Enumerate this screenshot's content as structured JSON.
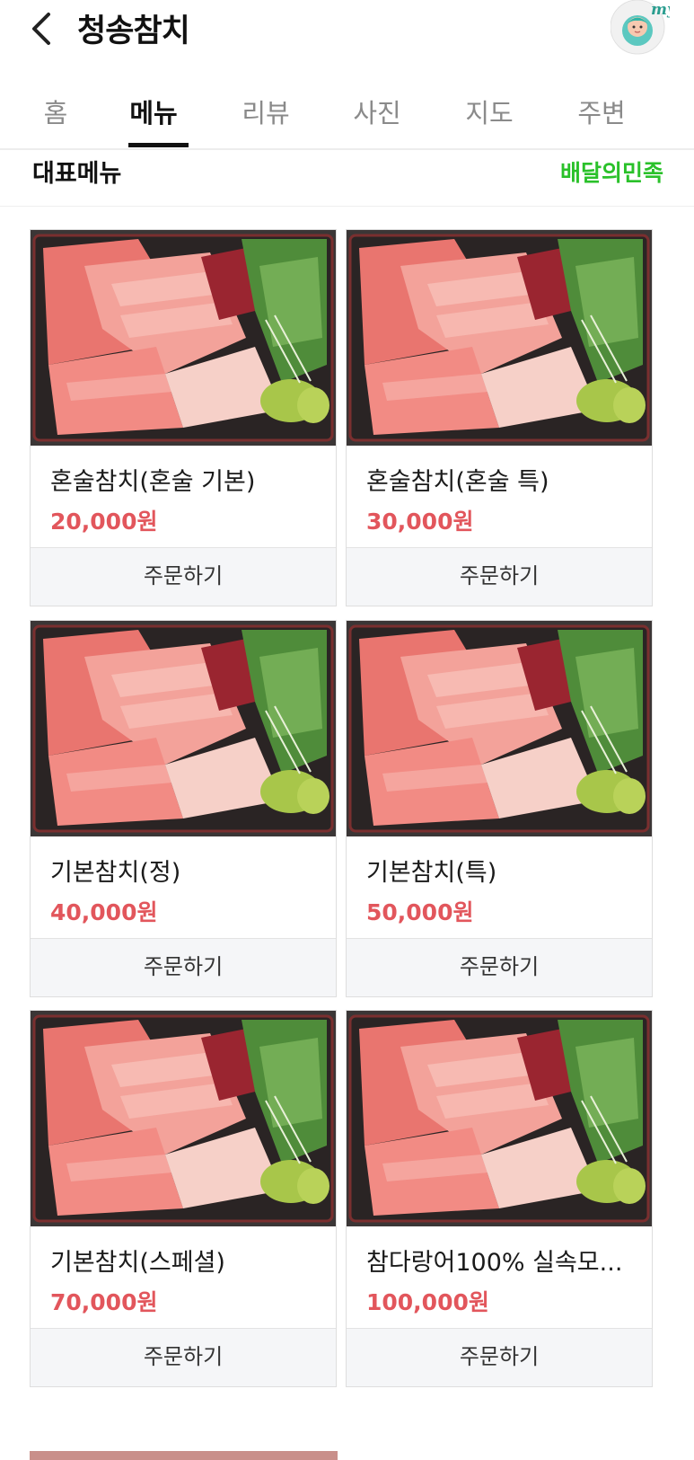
{
  "header": {
    "title": "청송참치",
    "avatar_label": "my"
  },
  "tabs": [
    {
      "label": "홈",
      "active": false
    },
    {
      "label": "메뉴",
      "active": true
    },
    {
      "label": "리뷰",
      "active": false
    },
    {
      "label": "사진",
      "active": false
    },
    {
      "label": "지도",
      "active": false
    },
    {
      "label": "주변",
      "active": false
    }
  ],
  "section": {
    "title": "대표메뉴",
    "link": "배달의민족"
  },
  "menu": [
    {
      "name": "혼술참치(혼술 기본)",
      "price": "20,000원",
      "order_label": "주문하기",
      "image_icon": "tuna-sashimi-platter"
    },
    {
      "name": "혼술참치(혼술 특)",
      "price": "30,000원",
      "order_label": "주문하기",
      "image_icon": "tuna-sashimi-platter"
    },
    {
      "name": "기본참치(정)",
      "price": "40,000원",
      "order_label": "주문하기",
      "image_icon": "tuna-sashimi-platter"
    },
    {
      "name": "기본참치(특)",
      "price": "50,000원",
      "order_label": "주문하기",
      "image_icon": "tuna-sashimi-platter"
    },
    {
      "name": "기본참치(스페셜)",
      "price": "70,000원",
      "order_label": "주문하기",
      "image_icon": "tuna-sashimi-platter"
    },
    {
      "name": "참다랑어100% 실속모...",
      "price": "100,000원",
      "order_label": "주문하기",
      "image_icon": "tuna-sashimi-platter"
    }
  ],
  "colors": {
    "price": "#e2565c",
    "brand_link": "#2ac12a",
    "active_tab": "#111111",
    "inactive_tab": "#8a8a8a"
  }
}
